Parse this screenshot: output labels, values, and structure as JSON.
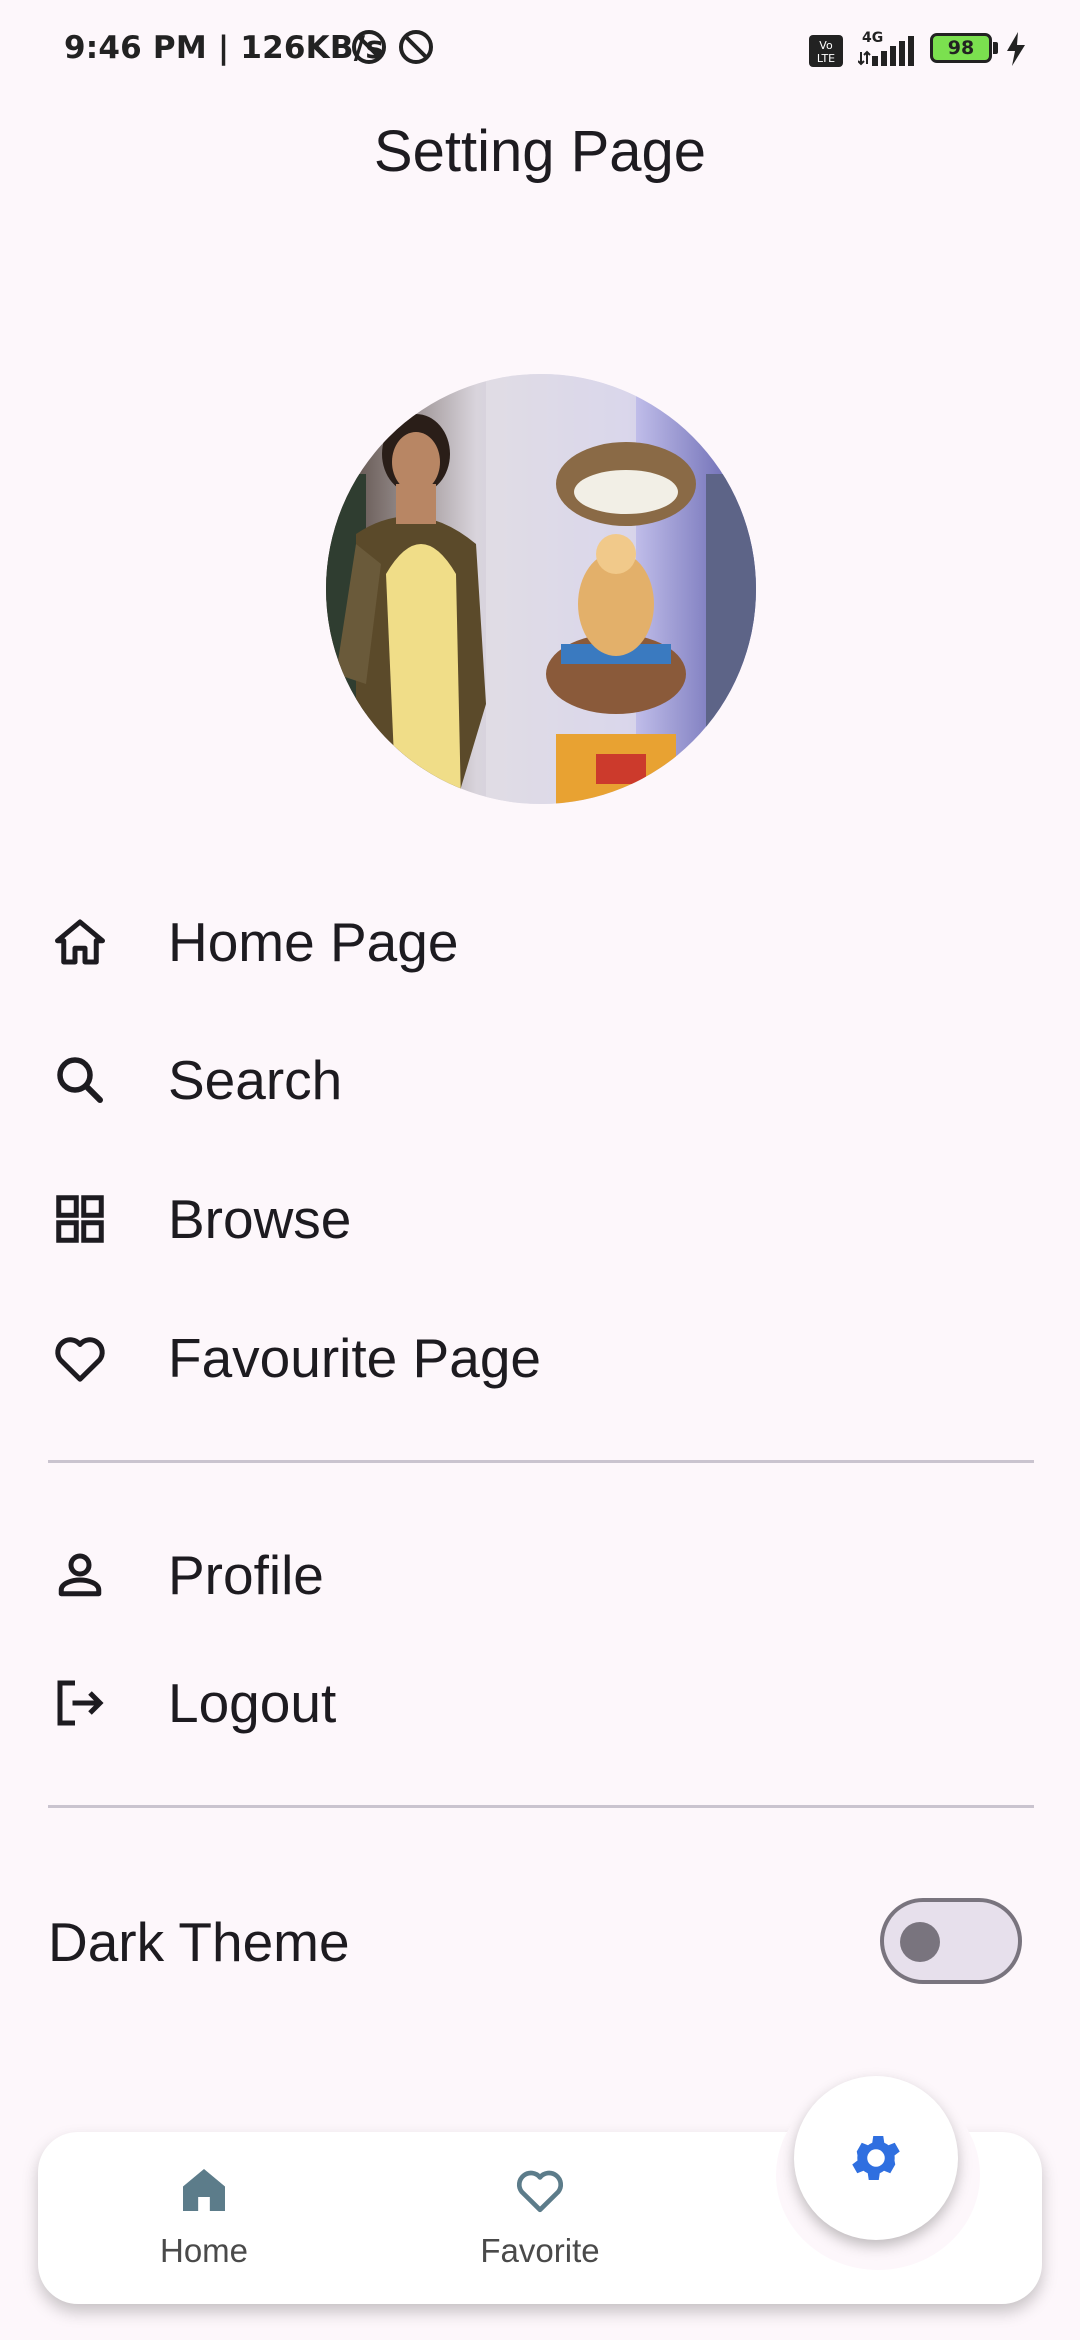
{
  "status_bar": {
    "time_speed": "9:46 PM | 126KB/s",
    "network": "4G",
    "battery": "98",
    "icons": [
      "at-sign-icon",
      "at-sign-icon",
      "volte-icon",
      "signal-icon",
      "battery-icon",
      "charging-icon"
    ]
  },
  "header": {
    "title": "Setting Page"
  },
  "profile": {
    "avatar_icon": "profile-photo"
  },
  "menu": {
    "items": [
      {
        "label": "Home Page",
        "icon": "home-icon"
      },
      {
        "label": "Search",
        "icon": "search-icon"
      },
      {
        "label": "Browse",
        "icon": "grid-icon"
      },
      {
        "label": "Favourite Page",
        "icon": "heart-icon"
      }
    ],
    "account_items": [
      {
        "label": "Profile",
        "icon": "person-icon"
      },
      {
        "label": "Logout",
        "icon": "logout-icon"
      }
    ]
  },
  "settings": {
    "dark_theme_label": "Dark Theme",
    "dark_theme_on": false
  },
  "bottom_nav": {
    "items": [
      {
        "label": "Home",
        "icon": "home-filled-icon"
      },
      {
        "label": "Favorite",
        "icon": "heart-icon"
      }
    ],
    "fab_icon": "gear-icon"
  },
  "colors": {
    "background": "#fdf7fb",
    "nav_icon": "#5c7c8a",
    "fab_icon": "#2f6fe0",
    "text": "#1d1b20"
  }
}
